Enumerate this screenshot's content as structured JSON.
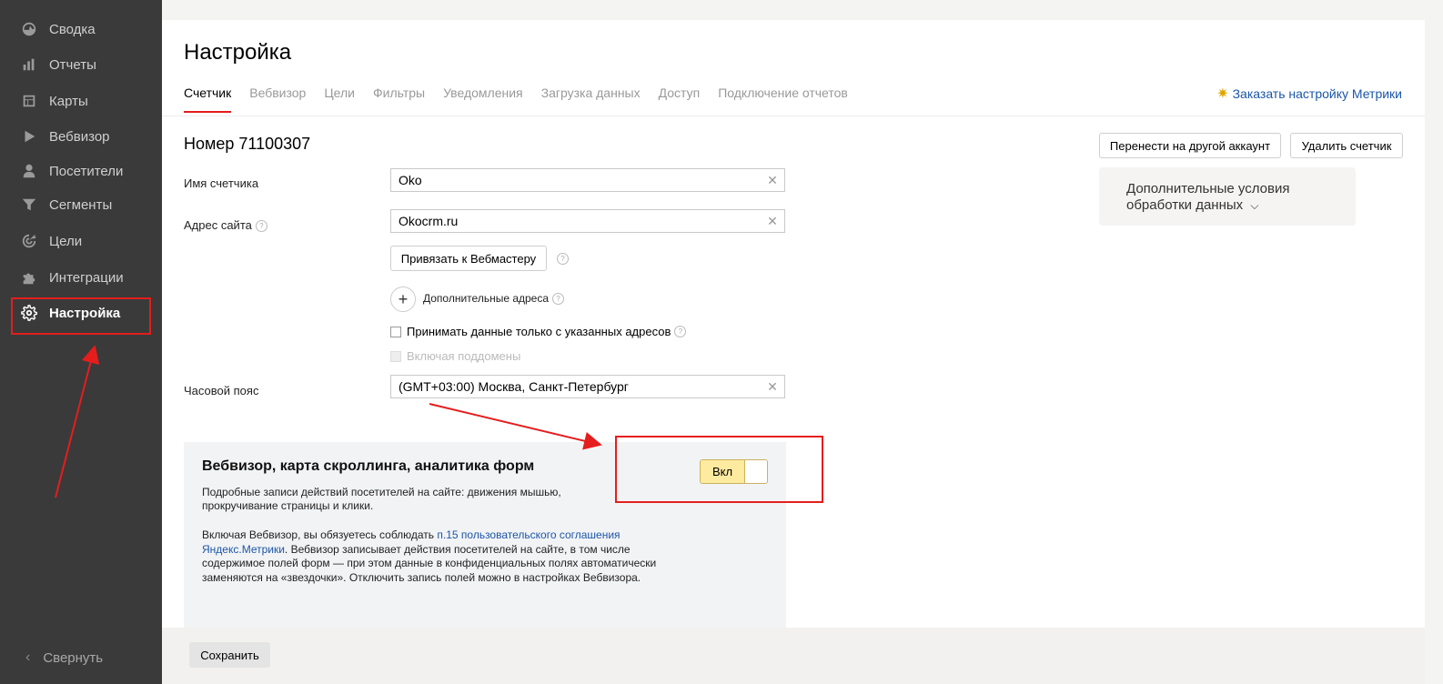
{
  "sidebar": {
    "items": [
      {
        "label": "Сводка",
        "icon": "dashboard-icon"
      },
      {
        "label": "Отчеты",
        "icon": "bar-chart-icon"
      },
      {
        "label": "Карты",
        "icon": "map-icon"
      },
      {
        "label": "Вебвизор",
        "icon": "play-icon"
      },
      {
        "label": "Посетители",
        "icon": "person-icon"
      },
      {
        "label": "Сегменты",
        "icon": "filter-icon"
      },
      {
        "label": "Цели",
        "icon": "target-icon"
      },
      {
        "label": "Интеграции",
        "icon": "puzzle-icon"
      },
      {
        "label": "Настройка",
        "icon": "gear-icon",
        "active": true
      }
    ],
    "collapse_label": "Свернуть"
  },
  "header": {
    "title": "Настройка",
    "tabs": [
      "Счетчик",
      "Вебвизор",
      "Цели",
      "Фильтры",
      "Уведомления",
      "Загрузка данных",
      "Доступ",
      "Подключение отчетов"
    ],
    "active_tab": "Счетчик",
    "order_link": "Заказать настройку Метрики"
  },
  "counter": {
    "number_label": "Номер 71100307",
    "name_label": "Имя счетчика",
    "name_value": "Oko",
    "site_label": "Адрес сайта",
    "site_value": "Okocrm.ru",
    "webmaster_button": "Привязать к Вебмастеру",
    "additional_addresses": "Дополнительные адреса",
    "only_listed_checkbox": "Принимать данные только с указанных адресов",
    "subdomains_checkbox": "Включая поддомены",
    "timezone_label": "Часовой пояс",
    "timezone_value": "(GMT+03:00) Москва, Санкт-Петербург"
  },
  "actions": {
    "transfer_button": "Перенести на другой аккаунт",
    "delete_button": "Удалить счетчик",
    "extra_conditions": "Дополнительные условия обработки данных"
  },
  "webvisor": {
    "title": "Вебвизор, карта скроллинга, аналитика форм",
    "description": "Подробные записи действий посетителей на сайте: движения мышью, прокручивание страницы и клики.",
    "agreement_prefix": "Включая Вебвизор, вы обязуетесь соблюдать ",
    "agreement_link": "п.15 пользовательского соглашения Яндекс.Метрики",
    "agreement_suffix": ". Вебвизор записывает действия посетителей на сайте, в том числе содержимое полей форм — при этом данные в конфиденциальных полях автоматически заменяются на «звездочки». Отключить запись полей можно в настройках Вебвизора.",
    "toggle_label": "Вкл"
  },
  "footer": {
    "save_button": "Сохранить"
  },
  "colors": {
    "accent_red": "#e51d1d",
    "link_blue": "#1b56a8",
    "toggle_yellow": "#ffeba0",
    "sidebar_bg": "#3a3a3a"
  }
}
